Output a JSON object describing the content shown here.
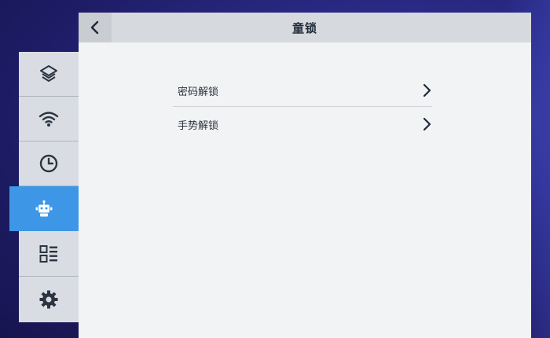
{
  "header": {
    "title": "童锁",
    "back_icon": "chevron-left-icon"
  },
  "sidebar": {
    "items": [
      {
        "icon": "layers-icon",
        "active": false
      },
      {
        "icon": "wifi-icon",
        "active": false
      },
      {
        "icon": "clock-icon",
        "active": false
      },
      {
        "icon": "robot-icon",
        "active": true
      },
      {
        "icon": "grid-list-icon",
        "active": false
      },
      {
        "icon": "gear-icon",
        "active": false
      }
    ],
    "active_color": "#3d97e6"
  },
  "main": {
    "options": [
      {
        "label": "密码解锁",
        "icon": "chevron-right-icon"
      },
      {
        "label": "手势解锁",
        "icon": "chevron-right-icon"
      }
    ]
  }
}
